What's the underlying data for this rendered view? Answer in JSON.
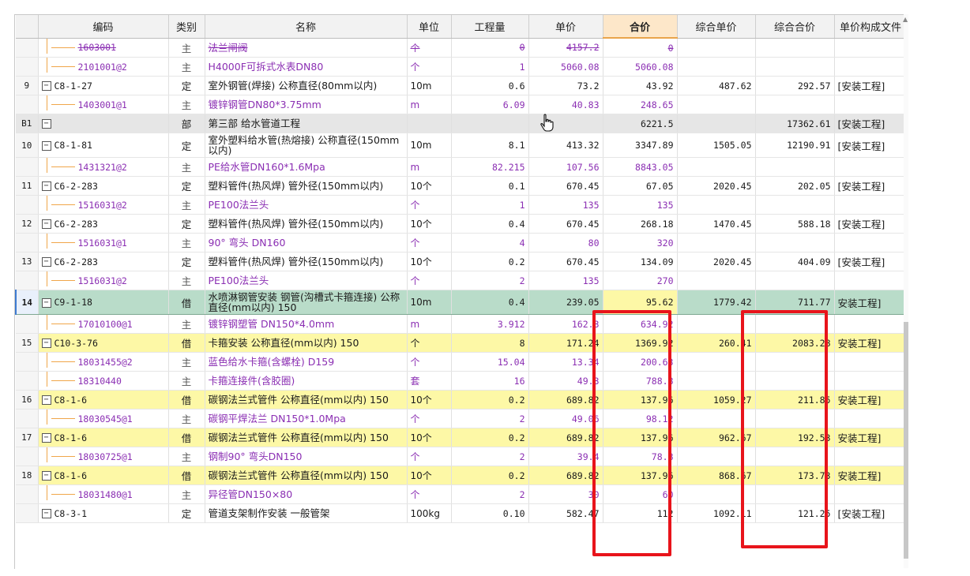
{
  "columns": [
    "编码",
    "类别",
    "名称",
    "单位",
    "工程量",
    "单价",
    "合价",
    "综合单价",
    "综合合价",
    "单价构成文件"
  ],
  "rows": [
    {
      "rn": "",
      "code": "1603001",
      "cat": "主",
      "name": "法兰闸阀",
      "unit": "个",
      "qty": "0",
      "price": "4157.2",
      "total": "0",
      "cprice": "",
      "ctotal": "",
      "file": "",
      "type": "mat",
      "style": "strike"
    },
    {
      "rn": "",
      "code": "2101001@2",
      "cat": "主",
      "name": "H4000F可拆式水表DN80",
      "unit": "个",
      "qty": "1",
      "price": "5060.08",
      "total": "5060.08",
      "cprice": "",
      "ctotal": "",
      "file": "",
      "type": "mat",
      "style": ""
    },
    {
      "rn": "9",
      "code": "C8-1-27",
      "cat": "定",
      "name": "室外钢管(焊接) 公称直径(80mm以内)",
      "unit": "10m",
      "qty": "0.6",
      "price": "73.2",
      "total": "43.92",
      "cprice": "487.62",
      "ctotal": "292.57",
      "file": "[安装工程]",
      "type": "main",
      "style": ""
    },
    {
      "rn": "",
      "code": "1403001@1",
      "cat": "主",
      "name": "镀锌钢管DN80*3.75mm",
      "unit": "m",
      "qty": "6.09",
      "price": "40.83",
      "total": "248.65",
      "cprice": "",
      "ctotal": "",
      "file": "",
      "type": "mat",
      "style": ""
    },
    {
      "rn": "B1",
      "code": "",
      "cat": "部",
      "name": "第三部 给水管道工程",
      "unit": "",
      "qty": "",
      "price": "",
      "total": "6221.5",
      "cprice": "",
      "ctotal": "17362.61",
      "file": "[安装工程]",
      "type": "main",
      "style": "sec"
    },
    {
      "rn": "10",
      "code": "C8-1-81",
      "cat": "定",
      "name": "室外塑料给水管(热熔接) 公称直径(150mm以内)",
      "unit": "10m",
      "qty": "8.1",
      "price": "413.32",
      "total": "3347.89",
      "cprice": "1505.05",
      "ctotal": "12190.91",
      "file": "[安装工程]",
      "type": "main",
      "style": "tall"
    },
    {
      "rn": "",
      "code": "1431321@2",
      "cat": "主",
      "name": "PE给水管DN160*1.6Mpa",
      "unit": "m",
      "qty": "82.215",
      "price": "107.56",
      "total": "8843.05",
      "cprice": "",
      "ctotal": "",
      "file": "",
      "type": "mat",
      "style": ""
    },
    {
      "rn": "11",
      "code": "C6-2-283",
      "cat": "定",
      "name": "塑料管件(热风焊) 管外径(150mm以内)",
      "unit": "10个",
      "qty": "0.1",
      "price": "670.45",
      "total": "67.05",
      "cprice": "2020.45",
      "ctotal": "202.05",
      "file": "[安装工程]",
      "type": "main",
      "style": ""
    },
    {
      "rn": "",
      "code": "1516031@2",
      "cat": "主",
      "name": "PE100法兰头",
      "unit": "个",
      "qty": "1",
      "price": "135",
      "total": "135",
      "cprice": "",
      "ctotal": "",
      "file": "",
      "type": "mat",
      "style": ""
    },
    {
      "rn": "12",
      "code": "C6-2-283",
      "cat": "定",
      "name": "塑料管件(热风焊) 管外径(150mm以内)",
      "unit": "10个",
      "qty": "0.4",
      "price": "670.45",
      "total": "268.18",
      "cprice": "1470.45",
      "ctotal": "588.18",
      "file": "[安装工程]",
      "type": "main",
      "style": ""
    },
    {
      "rn": "",
      "code": "1516031@1",
      "cat": "主",
      "name": "90° 弯头 DN160",
      "unit": "个",
      "qty": "4",
      "price": "80",
      "total": "320",
      "cprice": "",
      "ctotal": "",
      "file": "",
      "type": "mat",
      "style": ""
    },
    {
      "rn": "13",
      "code": "C6-2-283",
      "cat": "定",
      "name": "塑料管件(热风焊) 管外径(150mm以内)",
      "unit": "10个",
      "qty": "0.2",
      "price": "670.45",
      "total": "134.09",
      "cprice": "2020.45",
      "ctotal": "404.09",
      "file": "[安装工程]",
      "type": "main",
      "style": ""
    },
    {
      "rn": "",
      "code": "1516031@2",
      "cat": "主",
      "name": "PE100法兰头",
      "unit": "个",
      "qty": "2",
      "price": "135",
      "total": "270",
      "cprice": "",
      "ctotal": "",
      "file": "",
      "type": "mat",
      "style": ""
    },
    {
      "rn": "14",
      "code": "C9-1-18",
      "cat": "借",
      "name": "水喷淋钢管安装 钢管(沟槽式卡箍连接) 公称直径(mm以内) 150",
      "unit": "10m",
      "qty": "0.4",
      "price": "239.05",
      "total": "95.62",
      "cprice": "1779.42",
      "ctotal": "711.77",
      "file": "安装工程]",
      "type": "main",
      "style": "sel tall"
    },
    {
      "rn": "",
      "code": "17010100@1",
      "cat": "主",
      "name": "镀锌钢塑管 DN150*4.0mm",
      "unit": "m",
      "qty": "3.912",
      "price": "162.3",
      "total": "634.92",
      "cprice": "",
      "ctotal": "",
      "file": "",
      "type": "mat",
      "style": ""
    },
    {
      "rn": "15",
      "code": "C10-3-76",
      "cat": "借",
      "name": "卡箍安装 公称直径(mm以内) 150",
      "unit": "个",
      "qty": "8",
      "price": "171.24",
      "total": "1369.92",
      "cprice": "260.41",
      "ctotal": "2083.28",
      "file": "安装工程]",
      "type": "main",
      "style": "yel"
    },
    {
      "rn": "",
      "code": "18031455@2",
      "cat": "主",
      "name": "蓝色给水卡箍(含螺栓) D159",
      "unit": "个",
      "qty": "15.04",
      "price": "13.34",
      "total": "200.63",
      "cprice": "",
      "ctotal": "",
      "file": "",
      "type": "mat",
      "style": ""
    },
    {
      "rn": "",
      "code": "18310440",
      "cat": "主",
      "name": "卡箍连接件(含胶圈)",
      "unit": "套",
      "qty": "16",
      "price": "49.3",
      "total": "788.8",
      "cprice": "",
      "ctotal": "",
      "file": "",
      "type": "mat",
      "style": ""
    },
    {
      "rn": "16",
      "code": "C8-1-6",
      "cat": "借",
      "name": "碳钢法兰式管件 公称直径(mm以内) 150",
      "unit": "10个",
      "qty": "0.2",
      "price": "689.82",
      "total": "137.96",
      "cprice": "1059.27",
      "ctotal": "211.85",
      "file": "安装工程]",
      "type": "main",
      "style": "yel"
    },
    {
      "rn": "",
      "code": "18030545@1",
      "cat": "主",
      "name": "碳钢平焊法兰 DN150*1.0Mpa",
      "unit": "个",
      "qty": "2",
      "price": "49.06",
      "total": "98.12",
      "cprice": "",
      "ctotal": "",
      "file": "",
      "type": "mat",
      "style": ""
    },
    {
      "rn": "17",
      "code": "C8-1-6",
      "cat": "借",
      "name": "碳钢法兰式管件 公称直径(mm以内) 150",
      "unit": "10个",
      "qty": "0.2",
      "price": "689.82",
      "total": "137.96",
      "cprice": "962.67",
      "ctotal": "192.53",
      "file": "安装工程]",
      "type": "main",
      "style": "yel"
    },
    {
      "rn": "",
      "code": "18030725@1",
      "cat": "主",
      "name": "钢制90° 弯头DN150",
      "unit": "个",
      "qty": "2",
      "price": "39.4",
      "total": "78.8",
      "cprice": "",
      "ctotal": "",
      "file": "",
      "type": "mat",
      "style": ""
    },
    {
      "rn": "18",
      "code": "C8-1-6",
      "cat": "借",
      "name": "碳钢法兰式管件 公称直径(mm以内) 150",
      "unit": "10个",
      "qty": "0.2",
      "price": "689.82",
      "total": "137.96",
      "cprice": "868.67",
      "ctotal": "173.73",
      "file": "安装工程]",
      "type": "main",
      "style": "yel"
    },
    {
      "rn": "",
      "code": "18031480@1",
      "cat": "主",
      "name": "异径管DN150×80",
      "unit": "个",
      "qty": "2",
      "price": "30",
      "total": "60",
      "cprice": "",
      "ctotal": "",
      "file": "",
      "type": "mat",
      "style": ""
    },
    {
      "rn": "",
      "code": "C8-3-1",
      "cat": "定",
      "name": "管道支架制作安装 一般管架",
      "unit": "100kg",
      "qty": "0.10",
      "price": "582.47",
      "total": "112",
      "cprice": "1092.11",
      "ctotal": "121.25",
      "file": "[安装工程]",
      "type": "main",
      "style": ""
    }
  ],
  "colors": {
    "highlight_box": "#e8141b",
    "selected_row": "#b9dcc9",
    "yellow_row": "#fdf8a6",
    "material_text": "#8b2fb3"
  },
  "icons": {
    "toggle": "minus-square-icon",
    "cursor": "hand-pointer-icon"
  }
}
